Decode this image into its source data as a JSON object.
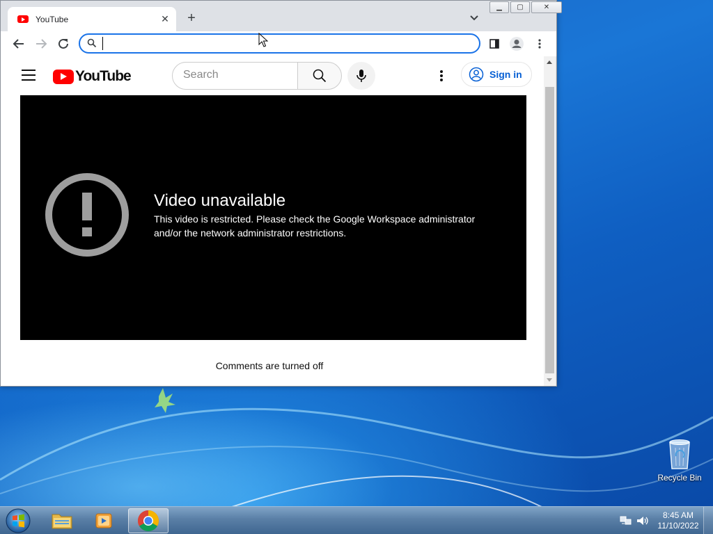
{
  "browser": {
    "tab": {
      "title": "YouTube",
      "favicon": "youtube-favicon-icon"
    },
    "new_tab_icon": "plus-icon",
    "window_controls": [
      "minimize-icon",
      "maximize-icon",
      "close-icon"
    ],
    "toolbar": {
      "back_icon": "arrow-left-icon",
      "forward_icon": "arrow-right-icon",
      "reload_icon": "reload-icon",
      "address_value": "",
      "side_panel_icon": "side-panel-icon",
      "profile_icon": "profile-icon",
      "menu_icon": "kebab-menu-icon"
    }
  },
  "youtube": {
    "logo_text": "YouTube",
    "search": {
      "placeholder": "Search"
    },
    "sign_in_label": "Sign in",
    "brand_color": "#ff0000",
    "link_color": "#065fd4",
    "player": {
      "title": "Video unavailable",
      "message": "This video is restricted. Please check the Google Workspace administrator and/or the network administrator restrictions."
    },
    "comments_status": "Comments are turned off"
  },
  "desktop": {
    "icons": [
      {
        "label": "Recycle Bin"
      }
    ]
  },
  "taskbar": {
    "pinned": [
      "start-orb-icon",
      "file-explorer-icon",
      "media-player-icon",
      "chrome-icon"
    ],
    "active": "chrome-icon",
    "clock": {
      "time": "8:45 AM",
      "date": "11/10/2022"
    }
  }
}
